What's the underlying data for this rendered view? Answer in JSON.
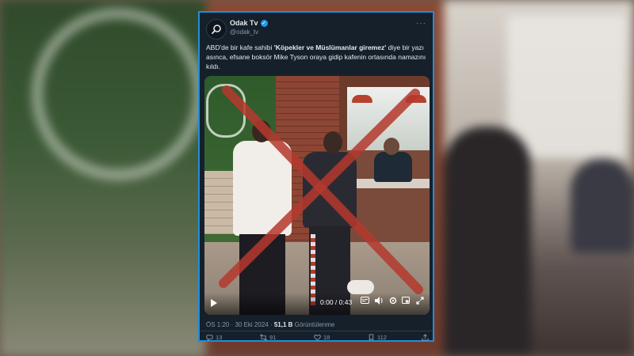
{
  "tweet": {
    "account_name": "Odak Tv",
    "handle": "@odak_tv",
    "text_before": "ABD'de bir kafe sahibi ",
    "text_bold": "'Köpekler ve Müslümanlar giremez'",
    "text_after": " diye bir yazı asınca, efsane boksör Mike Tyson oraya gidip kafenin ortasında namazını kıldı.",
    "timestamp": "ÖS 1:20 · 30 Eki 2024 · ",
    "views_count": "51,1 B",
    "views_label": " Görüntülenme",
    "replies": "13",
    "retweets": "91",
    "likes": "18",
    "bookmarks": "112"
  },
  "video": {
    "time": "0:00 / 0:43",
    "icons": [
      "play-icon",
      "captions-icon",
      "volume-icon",
      "settings-icon",
      "pip-icon",
      "replay-icon",
      "fullscreen-icon"
    ]
  },
  "colors": {
    "card_bg": "#15202b",
    "card_border": "#1d8fe0",
    "verified": "#1d9bf0",
    "cross": "#b5392e"
  }
}
